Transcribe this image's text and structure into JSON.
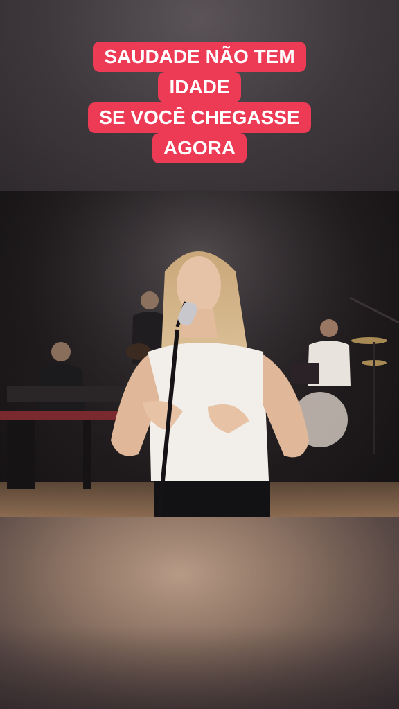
{
  "caption": {
    "lines": [
      "SAUDADE NÃO TEM",
      "IDADE",
      "SE VOCÊ CHEGASSE",
      "AGORA"
    ],
    "background_color": "#ee3b55",
    "text_color": "#ffffff"
  },
  "video": {
    "scene": "live-music-performance"
  }
}
